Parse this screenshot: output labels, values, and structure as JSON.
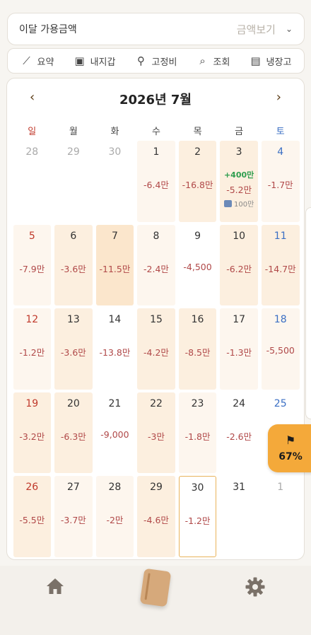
{
  "topbar": {
    "label": "이달 가용금액",
    "toggle_label": "금액보기",
    "chevron_icon": "chevron-down-icon"
  },
  "quickbar": [
    {
      "icon": "sparkle-chart-icon",
      "label": "요약"
    },
    {
      "icon": "wallet-icon",
      "label": "내지갑"
    },
    {
      "icon": "pin-icon",
      "label": "고정비"
    },
    {
      "icon": "search-icon",
      "label": "조회"
    },
    {
      "icon": "fridge-icon",
      "label": "냉장고"
    }
  ],
  "calendar": {
    "title": "2026년 7월",
    "prev_icon": "chevron-left-icon",
    "next_icon": "chevron-right-icon",
    "weekdays": [
      "일",
      "월",
      "화",
      "수",
      "목",
      "금",
      "토"
    ],
    "days": [
      {
        "day": "28",
        "spend": "",
        "other": true,
        "heat": 0
      },
      {
        "day": "29",
        "spend": "",
        "other": true,
        "heat": 0
      },
      {
        "day": "30",
        "spend": "",
        "other": true,
        "heat": 0
      },
      {
        "day": "1",
        "spend": "-6.4만",
        "heat": 1
      },
      {
        "day": "2",
        "spend": "-16.8만",
        "heat": 2
      },
      {
        "day": "3",
        "income": "+400만",
        "spend": "-5.2만",
        "note": "100만",
        "heat": 2
      },
      {
        "day": "4",
        "spend": "-1.7만",
        "heat": 1
      },
      {
        "day": "5",
        "spend": "-7.9만",
        "heat": 1
      },
      {
        "day": "6",
        "spend": "-3.6만",
        "heat": 2
      },
      {
        "day": "7",
        "spend": "-11.5만",
        "heat": 3
      },
      {
        "day": "8",
        "spend": "-2.4만",
        "heat": 1
      },
      {
        "day": "9",
        "spend": "-4,500",
        "heat": 0
      },
      {
        "day": "10",
        "spend": "-6.2만",
        "heat": 2
      },
      {
        "day": "11",
        "spend": "-14.7만",
        "heat": 2
      },
      {
        "day": "12",
        "spend": "-1.2만",
        "heat": 1
      },
      {
        "day": "13",
        "spend": "-3.6만",
        "heat": 2
      },
      {
        "day": "14",
        "spend": "-13.8만",
        "heat": 0
      },
      {
        "day": "15",
        "spend": "-4.2만",
        "heat": 2
      },
      {
        "day": "16",
        "spend": "-8.5만",
        "heat": 2
      },
      {
        "day": "17",
        "spend": "-1.3만",
        "heat": 1
      },
      {
        "day": "18",
        "spend": "-5,500",
        "heat": 1
      },
      {
        "day": "19",
        "spend": "-3.2만",
        "heat": 2
      },
      {
        "day": "20",
        "spend": "-6.3만",
        "heat": 2
      },
      {
        "day": "21",
        "spend": "-9,000",
        "heat": 0
      },
      {
        "day": "22",
        "spend": "-3만",
        "heat": 2
      },
      {
        "day": "23",
        "spend": "-1.8만",
        "heat": 1
      },
      {
        "day": "24",
        "spend": "-2.6만",
        "heat": 0
      },
      {
        "day": "25",
        "spend": "",
        "heat": 0
      },
      {
        "day": "26",
        "spend": "-5.5만",
        "heat": 2
      },
      {
        "day": "27",
        "spend": "-3.7만",
        "heat": 1
      },
      {
        "day": "28",
        "spend": "-2만",
        "heat": 1
      },
      {
        "day": "29",
        "spend": "-4.6만",
        "heat": 2
      },
      {
        "day": "30",
        "spend": "-1.2만",
        "today": true,
        "heat": 0
      },
      {
        "day": "31",
        "spend": "",
        "heat": 0
      },
      {
        "day": "1",
        "spend": "",
        "other": true,
        "heat": 0
      }
    ]
  },
  "flag_badge": {
    "icon": "flag-icon",
    "percent": "67%"
  },
  "bottom_nav": {
    "items": [
      {
        "icon": "home-icon"
      },
      {
        "icon": "book-icon"
      },
      {
        "icon": "gear-icon"
      }
    ]
  },
  "colors": {
    "sunday": "#c0392b",
    "saturday": "#3b6fc4",
    "spend": "#b04848",
    "income": "#2e9d4e",
    "badge": "#f4a93a"
  }
}
